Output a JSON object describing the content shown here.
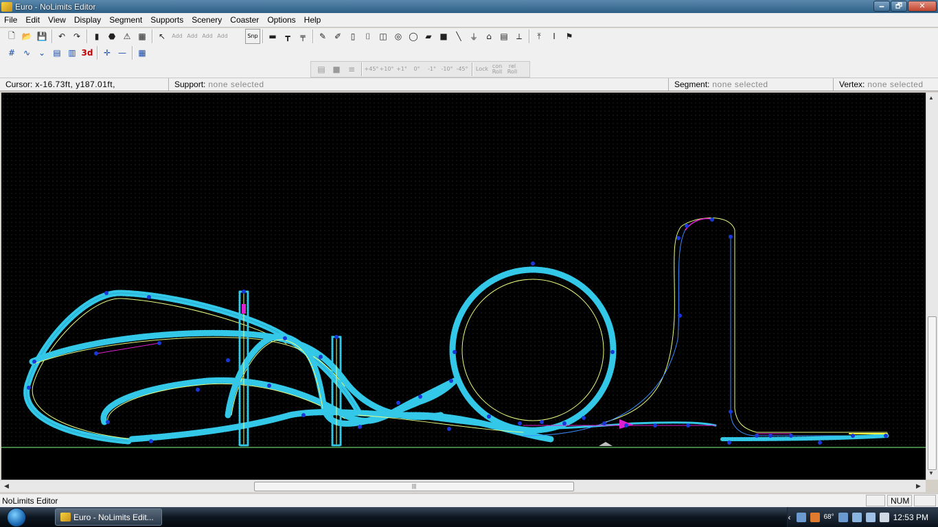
{
  "window": {
    "title": "Euro - NoLimits Editor",
    "minimize_glyph": "🗕",
    "restore_glyph": "🗗",
    "close_glyph": "✕"
  },
  "menu": [
    "File",
    "Edit",
    "View",
    "Display",
    "Segment",
    "Supports",
    "Scenery",
    "Coaster",
    "Options",
    "Help"
  ],
  "toolbar1": {
    "icons": [
      "new-file-icon",
      "open-folder-icon",
      "save-icon",
      "undo-icon",
      "redo-icon",
      "traffic-light-icon",
      "stop-icon",
      "warning-icon",
      "film-icon",
      "select-arrow-icon",
      "add-vertex-icon",
      "add-segment-icon",
      "add-support-icon",
      "add-connector-icon",
      "add-footer-icon",
      "snap-icon",
      "car-icon",
      "support-tool-icon",
      "crossbar-icon",
      "pencil-icon",
      "double-pencil-icon",
      "pillar-icon",
      "cylinder-icon",
      "barrel-icon",
      "drum-icon",
      "tube-icon",
      "bar-icon",
      "box-icon",
      "slope-icon",
      "tower-icon",
      "station-icon",
      "building-icon",
      "crane-icon",
      "lift-icon",
      "column-icon",
      "flag-icon"
    ],
    "add_labels": [
      "Add",
      "Add",
      "Add",
      "Add"
    ],
    "snap_label": "Snp"
  },
  "toolbar2": {
    "icons": [
      "grid-icon",
      "wave-icon",
      "dip-icon",
      "train-icon",
      "train-view-icon",
      "threed-icon",
      "crosshair-icon",
      "minus-icon",
      "map-icon"
    ],
    "threed_label": "3d"
  },
  "toolbar3": {
    "icons": [
      "table-icon",
      "grey-box-icon",
      "align-icon"
    ],
    "roll_labels": [
      "+45°",
      "+10°",
      "+1°",
      "0°",
      "-1°",
      "-10°",
      "-45°"
    ],
    "lock_label": "Lock",
    "con_roll_label": "con Roll",
    "rel_roll_label": "rel Roll"
  },
  "statusbar_top": {
    "cursor_label": "Cursor:",
    "cursor_value": "x-16.73ft, y187.01ft,",
    "support_label": "Support:",
    "support_value": "none selected",
    "segment_label": "Segment:",
    "segment_value": "none selected",
    "vertex_label": "Vertex:",
    "vertex_value": "none selected"
  },
  "scroll": {
    "hthumb_glyph": "|||",
    "left_arrow": "◀",
    "right_arrow": "▶",
    "up_arrow": "▲",
    "down_arrow": "▼"
  },
  "statusbar": {
    "text": "NoLimits Editor",
    "num": "NUM"
  },
  "taskbar": {
    "task_item": "Euro - NoLimits Edit...",
    "temperature": "68°",
    "clock": "12:53 PM"
  },
  "colors": {
    "track": "#33c8e8",
    "spine": "#e8ff80",
    "vertex": "#1838d8",
    "highlight": "#e020d0",
    "ground": "#80ff80"
  }
}
